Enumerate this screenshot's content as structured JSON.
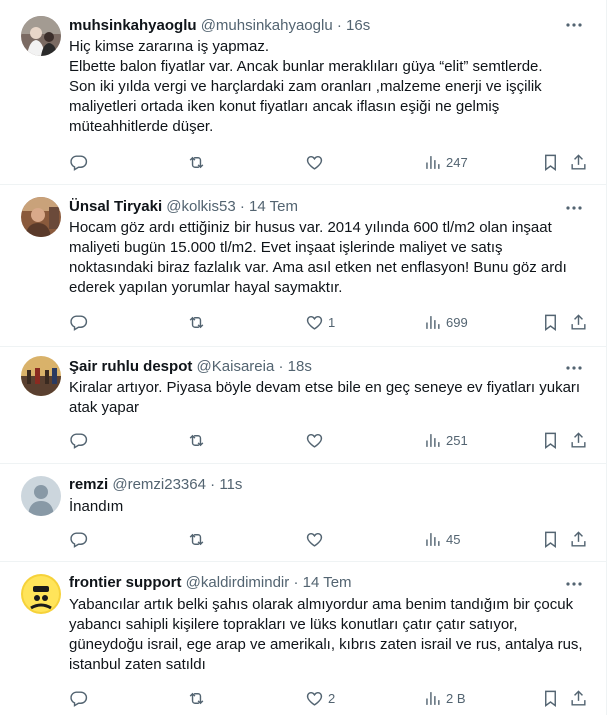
{
  "tweets": [
    {
      "name": "muhsinkahyaoglu",
      "handle": "@muhsinkahyaoglu",
      "separator": "·",
      "time": "16s",
      "lines": [
        "Hiç kimse zararına iş yapmaz.",
        "Elbette balon fiyatlar var. Ancak bunlar meraklıları güya “elit” semtlerde.",
        "Son iki yılda vergi ve harçlardaki zam oranları ,malzeme enerji ve işçilik",
        "maliyetleri ortada iken konut fiyatları ancak iflasın eşiği ne gelmiş",
        "müteahhitlerde düşer."
      ],
      "replies": "",
      "retweets": "",
      "likes": "",
      "views": "247"
    },
    {
      "name": "Ünsal Tiryaki",
      "handle": "@kolkis53",
      "separator": "·",
      "time": "14 Tem",
      "lines": [
        "Hocam göz ardı ettiğiniz bir husus var. 2014 yılında 600 tl/m2 olan inşaat",
        "maliyeti bugün 15.000 tl/m2. Evet inşaat işlerinde maliyet ve satış",
        "noktasındaki biraz fazlalık var. Ama asıl etken net enflasyon! Bunu göz ardı",
        "ederek yapılan yorumlar hayal saymaktır."
      ],
      "replies": "",
      "retweets": "",
      "likes": "1",
      "views": "699"
    },
    {
      "name": "Şair ruhlu despot",
      "handle": "@Kaisareia",
      "separator": "·",
      "time": "18s",
      "lines": [
        "Kiralar artıyor. Piyasa böyle devam etse bile en geç seneye ev fiyatları yukarı",
        "atak yapar"
      ],
      "replies": "",
      "retweets": "",
      "likes": "",
      "views": "251"
    },
    {
      "name": "remzi",
      "handle": "@remzi23364",
      "separator": "·",
      "time": "11s",
      "lines": [
        "İnandım"
      ],
      "replies": "",
      "retweets": "",
      "likes": "",
      "views": "45"
    },
    {
      "name": "frontier support",
      "handle": "@kaldirdimindir",
      "separator": "·",
      "time": "14 Tem",
      "lines": [
        "Yabancılar artık belki şahıs olarak almıyordur ama benim tandığım bir çocuk",
        "yabancı sahipli kişilere toprakları ve lüks konutları çatır çatır satıyor,",
        "güneydoğu israil, ege arap ve amerikalı, kıbrıs zaten israil ve rus, antalya rus,",
        "istanbul zaten satıldı"
      ],
      "replies": "",
      "retweets": "",
      "likes": "2",
      "views": "2 B"
    }
  ],
  "icons": {
    "more": "more-horizontal-icon",
    "reply": "reply-icon",
    "retweet": "retweet-icon",
    "like": "heart-icon",
    "views": "views-chart-icon",
    "bookmark": "bookmark-icon",
    "share": "share-icon"
  },
  "colors": {
    "text": "#0f1419",
    "muted": "#536471",
    "border": "#eff3f4",
    "background": "#ffffff"
  }
}
